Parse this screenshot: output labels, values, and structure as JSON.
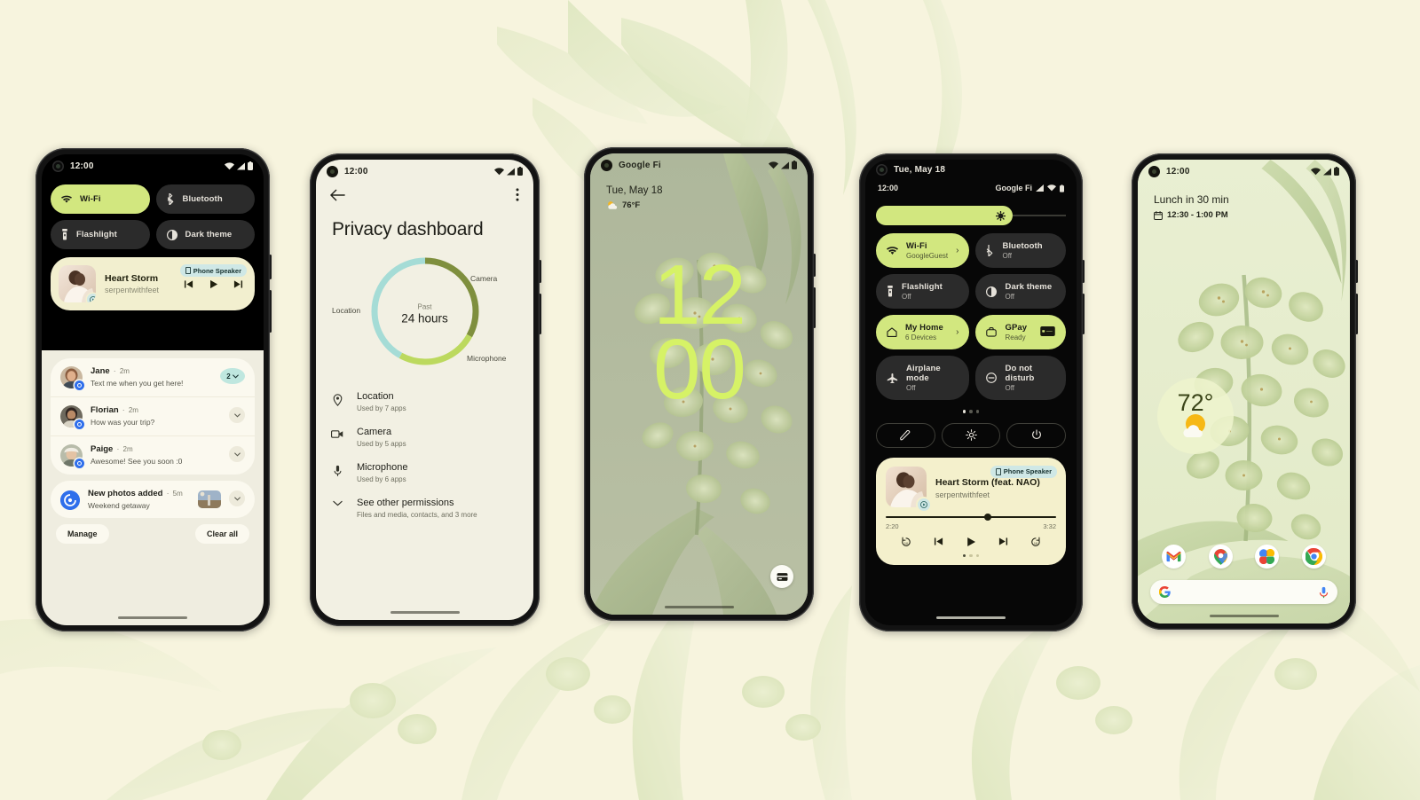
{
  "theme": {
    "page_background": "#F7F4DE",
    "accent_lime": "#D2E77F",
    "clock_lime": "#D6F266",
    "dark_tile": "#2B2B2B",
    "media_cream": "#F2EFCF",
    "chip_teal": "#CFE8E6",
    "donut_camera": "#7F8F3E",
    "donut_microphone": "#BCD95E",
    "donut_location": "#A5DCD6"
  },
  "phones": {
    "notifications": {
      "name": "Notification shade",
      "status": {
        "time": "12:00",
        "icons": [
          "wifi-icon",
          "signal-icon",
          "battery-icon"
        ]
      },
      "tiles": [
        {
          "label": "Wi-Fi",
          "icon": "wifi-icon",
          "state": "on"
        },
        {
          "label": "Bluetooth",
          "icon": "bluetooth-icon",
          "state": "off"
        },
        {
          "label": "Flashlight",
          "icon": "flashlight-icon",
          "state": "off"
        },
        {
          "label": "Dark theme",
          "icon": "dark-theme-icon",
          "state": "off"
        }
      ],
      "media": {
        "title": "Heart Storm",
        "artist": "serpentwithfeet",
        "output_chip": "Phone Speaker",
        "output_icon": "phone-speaker-icon",
        "controls": [
          "previous-track",
          "play",
          "next-track"
        ]
      },
      "notifications": [
        {
          "sender": "Jane",
          "time": "2m",
          "message": "Text me when you get here!",
          "count": "2",
          "has_count": true,
          "has_thumb": false
        },
        {
          "sender": "Florian",
          "time": "2m",
          "message": "How was your trip?",
          "count": "",
          "has_count": false,
          "has_thumb": false
        },
        {
          "sender": "Paige",
          "time": "2m",
          "message": "Awesome! See you soon :0",
          "count": "",
          "has_count": false,
          "has_thumb": false
        }
      ],
      "photo_notification": {
        "sender": "New photos added",
        "time": "5m",
        "message": "Weekend getaway",
        "has_thumb": true
      },
      "actions": {
        "manage": "Manage",
        "clear_all": "Clear all"
      }
    },
    "privacy": {
      "name": "Privacy dashboard",
      "status": {
        "time": "12:00"
      },
      "topbar": {
        "back": "back-arrow-icon",
        "overflow": "more-options-icon"
      },
      "title": "Privacy dashboard",
      "donut_center": {
        "past": "Past",
        "duration": "24 hours"
      },
      "donut_labels": {
        "camera": "Camera",
        "microphone": "Microphone",
        "location": "Location"
      },
      "permissions": [
        {
          "name": "Location",
          "sub": "Used by 7 apps",
          "icon": "location-pin-icon"
        },
        {
          "name": "Camera",
          "sub": "Used by 5 apps",
          "icon": "camera-icon"
        },
        {
          "name": "Microphone",
          "sub": "Used by 6 apps",
          "icon": "microphone-icon"
        }
      ],
      "see_other": {
        "name": "See other permissions",
        "sub": "Files and media, contacts, and 3 more",
        "icon": "chevron-down-icon"
      }
    },
    "lockscreen": {
      "name": "Lock screen",
      "status": {
        "carrier": "Google Fi"
      },
      "date": "Tue, May 18",
      "weather": {
        "temp": "76°F",
        "icon": "partly-cloudy-icon"
      },
      "clock": {
        "hours": "12",
        "minutes": "00"
      },
      "wallet_button": "wallet-icon"
    },
    "quicksettings": {
      "name": "Quick settings",
      "status": {
        "date": "Tue, May 18"
      },
      "header": {
        "time": "12:00",
        "carrier": "Google Fi"
      },
      "brightness": {
        "icon": "brightness-icon",
        "value_percent": 72
      },
      "tiles": [
        {
          "label": "Wi-Fi",
          "sub": "GoogleGuest",
          "icon": "wifi-icon",
          "state": "on",
          "chevron": true
        },
        {
          "label": "Bluetooth",
          "sub": "Off",
          "icon": "bluetooth-icon",
          "state": "off",
          "chevron": false
        },
        {
          "label": "Flashlight",
          "sub": "Off",
          "icon": "flashlight-icon",
          "state": "off",
          "chevron": false
        },
        {
          "label": "Dark theme",
          "sub": "Off",
          "icon": "dark-theme-icon",
          "state": "off",
          "chevron": false
        },
        {
          "label": "My Home",
          "sub": "6 Devices",
          "icon": "home-icon",
          "state": "on",
          "chevron": true
        },
        {
          "label": "GPay",
          "sub": "Ready",
          "icon": "wallet-icon",
          "state": "on",
          "chevron": false
        },
        {
          "label": "Airplane mode",
          "sub": "Off",
          "icon": "airplane-icon",
          "state": "off",
          "chevron": false
        },
        {
          "label": "Do not disturb",
          "sub": "Off",
          "icon": "do-not-disturb-icon",
          "state": "off",
          "chevron": false
        }
      ],
      "footer_buttons": [
        "edit-icon",
        "settings-gear-icon",
        "power-icon"
      ],
      "media": {
        "title": "Heart Storm (feat. NAO)",
        "artist": "serpentwithfeet",
        "output_chip": "Phone Speaker",
        "elapsed": "2:20",
        "duration": "3:32",
        "progress_percent": 58,
        "controls": [
          "rewind-10",
          "previous-track",
          "play",
          "next-track",
          "forward-10"
        ]
      }
    },
    "homescreen": {
      "name": "Home screen",
      "status": {
        "time": "12:00"
      },
      "calendar": {
        "title": "Lunch in 30 min",
        "range": "12:30 - 1:00 PM",
        "icon": "calendar-icon"
      },
      "weather": {
        "temp": "72°",
        "icon": "sunny-cloud-icon"
      },
      "dock": [
        {
          "name": "gmail-icon",
          "label": "Gmail"
        },
        {
          "name": "maps-icon",
          "label": "Maps"
        },
        {
          "name": "photos-icon",
          "label": "Photos"
        },
        {
          "name": "chrome-icon",
          "label": "Chrome"
        }
      ],
      "search": {
        "left_icon": "google-g-icon",
        "right_icon": "microphone-icon",
        "placeholder": ""
      }
    }
  },
  "chart_data": {
    "type": "pie",
    "title": "Privacy dashboard — permission usage, past 24 hours",
    "categories": [
      "Camera",
      "Microphone",
      "Location"
    ],
    "values": [
      33,
      25,
      42
    ],
    "colors": [
      "#7F8F3E",
      "#BCD95E",
      "#A5DCD6"
    ],
    "center_label": "Past 24 hours",
    "legend_position": "around-ring",
    "notes": "Donut ring; segment arcs read clockwise from 12 o'clock: Camera ~120°, Microphone ~90°, Location ~150°"
  }
}
